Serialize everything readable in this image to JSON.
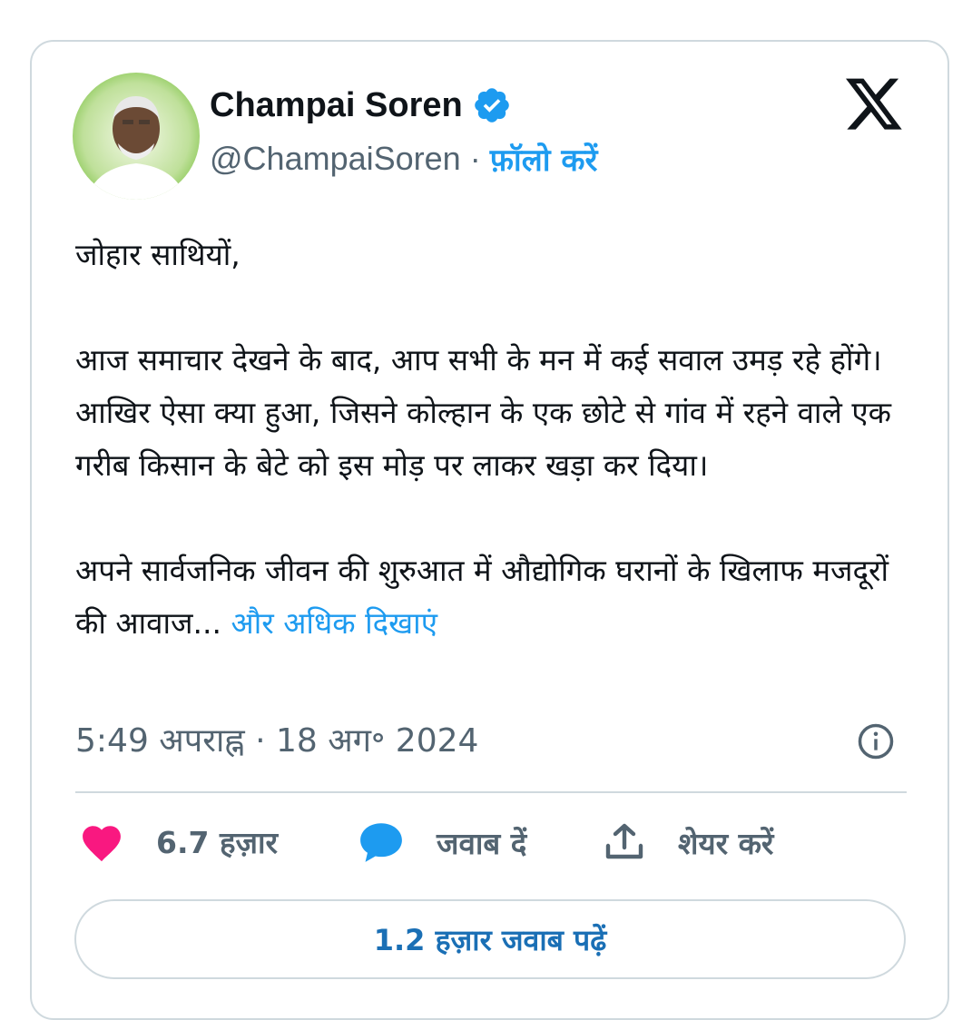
{
  "author": {
    "name": "Champai Soren",
    "handle": "@ChampaiSoren",
    "separator": "·",
    "follow_label": "फ़ॉलो करें",
    "verified_icon": "verified-badge-icon",
    "avatar_icon": "profile-avatar"
  },
  "tweet": {
    "paragraphs": [
      "जोहार साथियों,",
      "आज समाचार देखने के बाद, आप सभी के मन में कई सवाल उमड़ रहे होंगे। आखिर ऐसा क्या हुआ, जिसने कोल्हान के एक छोटे से गांव में रहने वाले एक गरीब किसान के बेटे को इस मोड़ पर लाकर खड़ा कर दिया।",
      "अपने सार्वजनिक जीवन की शुरुआत में औद्योगिक घरानों के खिलाफ मजदूरों की आवाज..."
    ],
    "show_more": "और अधिक दिखाएं",
    "timestamp": "5:49 अपराह्न · 18 अग॰ 2024"
  },
  "actions": {
    "likes": "6.7 हज़ार",
    "reply": "जवाब दें",
    "share": "शेयर करें"
  },
  "read_replies": "1.2 हज़ार जवाब पढ़ें",
  "colors": {
    "accent": "#1d9bf0",
    "like": "#f91880",
    "border": "#cfd9de",
    "secondary_text": "#536471"
  }
}
